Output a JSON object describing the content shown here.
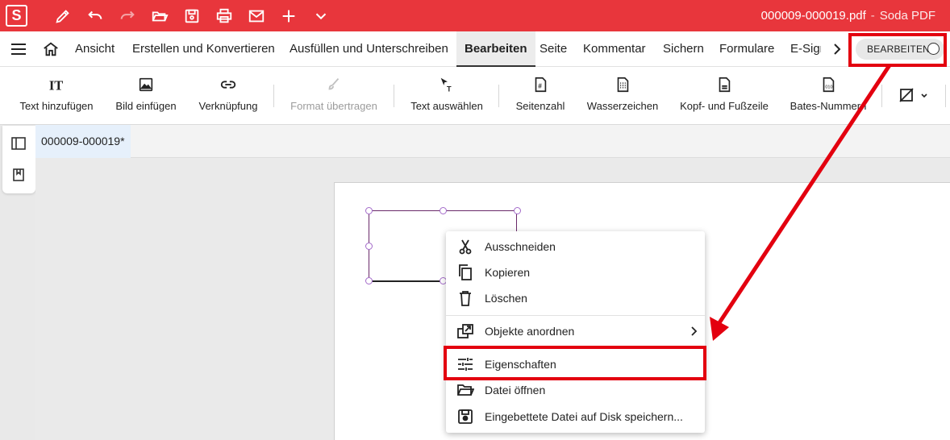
{
  "titlebar": {
    "logo": "S",
    "filename": "000009-000019.pdf",
    "separator": "-",
    "app_name": "Soda PDF",
    "quick_access_icons": [
      "pen-icon",
      "undo-icon",
      "redo-icon",
      "open-folder-icon",
      "save-icon",
      "print-icon",
      "mail-icon",
      "plus-icon",
      "chevron-down-icon"
    ]
  },
  "menubar": {
    "items": [
      "Ansicht",
      "Erstellen und Konvertieren",
      "Ausfüllen und Unterschreiben",
      "Bearbeiten",
      "Seite",
      "Kommentar",
      "Sichern",
      "Formulare",
      "E-Sign"
    ],
    "active": "Bearbeiten",
    "edit_toggle_label": "BEARBEITEN"
  },
  "ribbon": {
    "buttons": [
      {
        "label": "Text hinzufügen",
        "icon": "text-add-icon",
        "enabled": true
      },
      {
        "label": "Bild einfügen",
        "icon": "image-icon",
        "enabled": true
      },
      {
        "label": "Verknüpfung",
        "icon": "link-icon",
        "enabled": true
      },
      {
        "label": "Format übertragen",
        "icon": "brush-icon",
        "enabled": false
      },
      {
        "label": "Text auswählen",
        "icon": "text-select-icon",
        "enabled": true
      },
      {
        "label": "Seitenzahl",
        "icon": "page-number-icon",
        "enabled": true
      },
      {
        "label": "Wasserzeichen",
        "icon": "watermark-icon",
        "enabled": true
      },
      {
        "label": "Kopf- und Fußzeile",
        "icon": "header-footer-icon",
        "enabled": true
      },
      {
        "label": "Bates-Nummern",
        "icon": "bates-icon",
        "enabled": true
      }
    ]
  },
  "document_tab": {
    "name": "000009-000019*"
  },
  "context_menu": {
    "items": [
      {
        "label": "Ausschneiden",
        "icon": "scissors-icon"
      },
      {
        "label": "Kopieren",
        "icon": "copy-icon"
      },
      {
        "label": "Löschen",
        "icon": "trash-icon"
      },
      {
        "label": "Objekte anordnen",
        "icon": "arrange-icon",
        "submenu": true
      },
      {
        "label": "Eigenschaften",
        "icon": "sliders-icon",
        "highlighted": true
      },
      {
        "label": "Datei öffnen",
        "icon": "folder-open-icon"
      },
      {
        "label": "Eingebettete Datei auf Disk speichern...",
        "icon": "disk-icon"
      }
    ]
  },
  "colors": {
    "brand_red": "#e8363c",
    "annotation_red": "#e3000f"
  }
}
